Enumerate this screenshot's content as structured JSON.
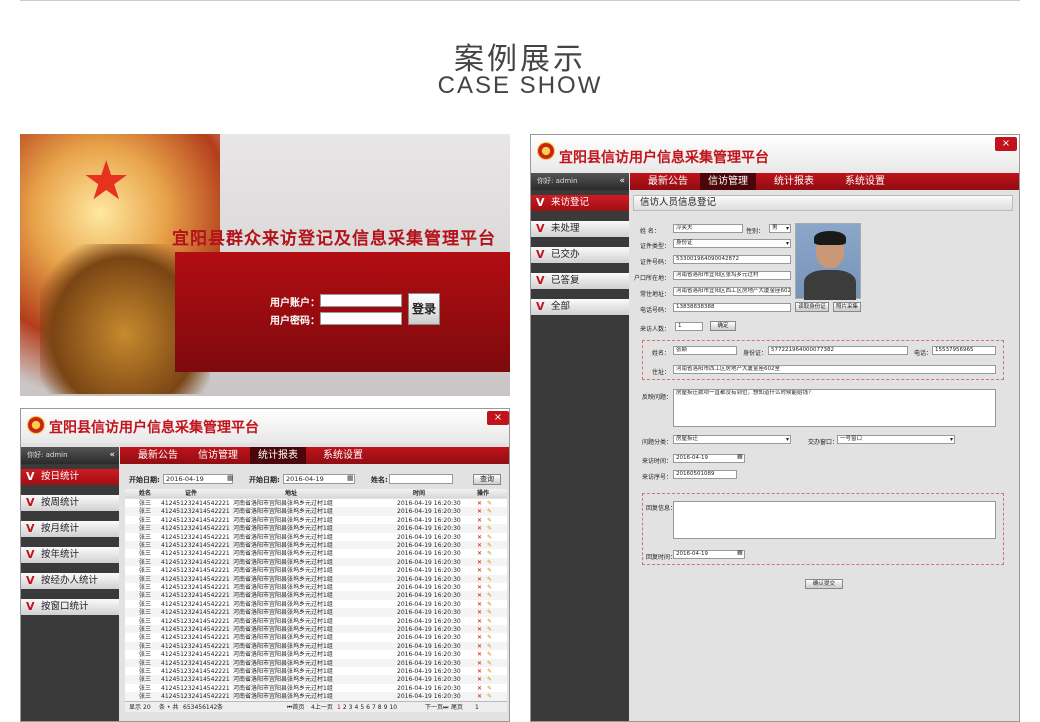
{
  "header": {
    "title_cn": "案例展示",
    "title_en": "CASE SHOW"
  },
  "login": {
    "platform_title": "宜阳县群众来访登记及信息采集管理平台",
    "account_label": "用户账户：",
    "password_label": "用户密码：",
    "login_button": "登录"
  },
  "app_title": "宜阳县信访用户信息采集管理平台",
  "nav": [
    "最新公告",
    "信访管理",
    "统计报表",
    "系统设置"
  ],
  "sidebar_greeting": "你好: admin",
  "collapse_icon": "«",
  "close_icon": "×",
  "stats": {
    "sidebar": [
      "按日统计",
      "按周统计",
      "按月统计",
      "按年统计",
      "按经办人统计",
      "按窗口统计"
    ],
    "filters": {
      "start_label": "开始日期:",
      "start_value": "2016-04-19",
      "end_label": "开始日期:",
      "end_value": "2016-04-19",
      "name_label": "姓名:",
      "query_button": "查询"
    },
    "columns": [
      "姓名",
      "证件",
      "地址",
      "时间",
      "操作"
    ],
    "row": {
      "name": "张三",
      "id": "412451232414542221",
      "address": "河南省洛阳市宜阳县张坞乡元过村1组",
      "time": "2016-04-19 16:20:30"
    },
    "row_count": 24,
    "pager": {
      "display": "显示",
      "per_page": "20",
      "unit": "条 • 共",
      "total": "653456142",
      "total_unit": "条",
      "first": "⏮首页",
      "prev": "4上一页",
      "pages": [
        "1",
        "2",
        "3",
        "4",
        "5",
        "6",
        "7",
        "8",
        "9",
        "10"
      ],
      "next": "下一页⏭",
      "last": "尾页",
      "jump": "1"
    }
  },
  "form": {
    "sidebar": [
      "来访登记",
      "未处理",
      "已交办",
      "已答复",
      "全部"
    ],
    "section_title": "信访人员信息登记",
    "fields": {
      "name_label": "姓    名：",
      "name_value": "冷笑夫",
      "gender_label": "性别：",
      "gender_value": "男",
      "idtype_label": "证件类型：",
      "idtype_value": "身份证",
      "idno_label": "证件号码：",
      "idno_value": "533001964090042872",
      "hukou_label": "户口所在地：",
      "hukou_value": "河南省洛阳市宜阳区张坞乡元过村",
      "address_label": "常住地址：",
      "address_value": "河南省洛阳市宜阳区西工区房地产大厦金座602室",
      "phone_label": "电话号码：",
      "phone_value": "13838838388",
      "read_id_button": "读取身份证",
      "photo_button": "照片采集",
      "visitors_label": "来访人数：",
      "visitors_value": "1",
      "confirm_button": "确定",
      "p_name_label": "姓名：",
      "p_name_value": "张颖",
      "p_id_label": "身份证：",
      "p_id_value": "577221964000077382",
      "p_phone_label": "电话：",
      "p_phone_value": "15537956965",
      "p_addr_label": "住址：",
      "p_addr_value": "河南省洛阳市西工区房地产大厦金座602室",
      "issue_label": "反映问题：",
      "issue_value": "房屋拆迁款项一直都没有到位，想知道什么时候能给钱？",
      "category_label": "问题分类：",
      "category_value": "房屋拆迁",
      "window_label": "交办窗口：",
      "window_value": "一号窗口",
      "visit_time_label": "来访时间：",
      "visit_time_value": "2016-04-19",
      "visit_no_label": "来访序号：",
      "visit_no_value": "20160501089",
      "reply_label": "回复信息：",
      "reply_time_label": "回复时间：",
      "reply_time_value": "2016-04-19",
      "submit_button": "确认提交"
    }
  },
  "colors": {
    "brand_red": "#c0131b",
    "dark_side": "#3a3a3a"
  }
}
